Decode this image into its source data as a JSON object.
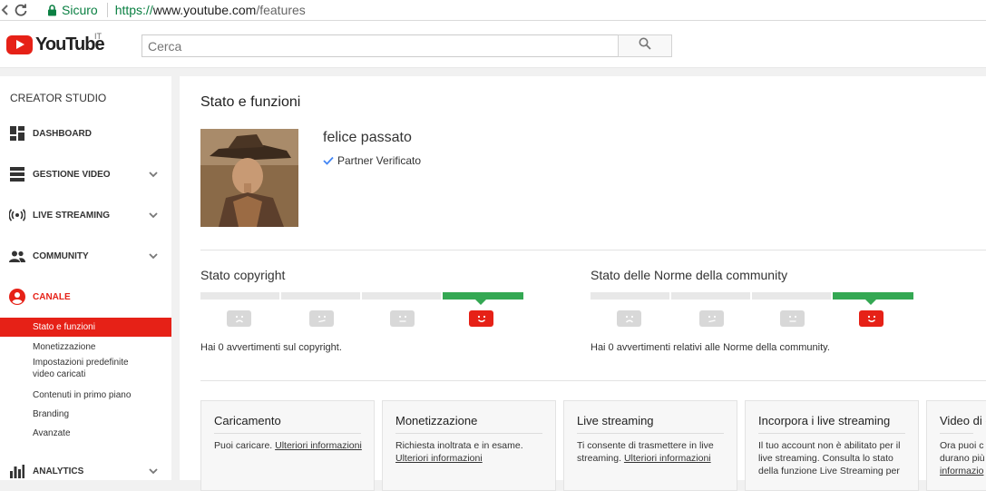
{
  "browser": {
    "secure_label": "Sicuro",
    "url_protocol": "https://",
    "url_host": "www.youtube.com",
    "url_path": "/features"
  },
  "header": {
    "logo_text": "YouTube",
    "country_code": "IT",
    "search_placeholder": "Cerca",
    "brand_color": "#e62117"
  },
  "sidebar": {
    "title": "CREATOR STUDIO",
    "items": [
      {
        "label": "DASHBOARD",
        "icon": "dashboard-icon"
      },
      {
        "label": "GESTIONE VIDEO",
        "icon": "video-manager-icon"
      },
      {
        "label": "LIVE STREAMING",
        "icon": "live-streaming-icon"
      },
      {
        "label": "COMMUNITY",
        "icon": "community-icon"
      },
      {
        "label": "CANALE",
        "icon": "channel-icon",
        "active": true
      },
      {
        "label": "ANALYTICS",
        "icon": "analytics-icon"
      }
    ],
    "subitems": [
      {
        "label": "Stato e funzioni",
        "active": true
      },
      {
        "label": "Monetizzazione"
      },
      {
        "label": "Impostazioni predefinite video caricati"
      },
      {
        "label": "Contenuti in primo piano"
      },
      {
        "label": "Branding"
      },
      {
        "label": "Avanzate"
      }
    ]
  },
  "main": {
    "title": "Stato e funzioni",
    "channel_name": "felice passato",
    "verified_label": "Partner Verificato",
    "copyright": {
      "title": "Stato copyright",
      "text": "Hai 0 avvertimenti sul copyright."
    },
    "community": {
      "title": "Stato delle Norme della community",
      "text": "Hai 0 avvertimenti relativi alle Norme della community."
    },
    "cards": [
      {
        "title": "Caricamento",
        "text": "Puoi caricare. ",
        "link": "Ulteriori informazioni"
      },
      {
        "title": "Monetizzazione",
        "text": "Richiesta inoltrata e in esame. ",
        "link": "Ulteriori informazioni"
      },
      {
        "title": "Live streaming",
        "text": "Ti consente di trasmettere in live streaming. ",
        "link": "Ulteriori informazioni"
      },
      {
        "title": "Incorpora i live streaming",
        "text": "Il tuo account non è abilitato per il live streaming. Consulta lo stato della funzione Live Streaming per",
        "link": ""
      },
      {
        "title": "Video di c",
        "text": "Ora puoi c durano più",
        "link": "informazio"
      }
    ],
    "status_colors": {
      "good": "#34a853",
      "active_face": "#e62117"
    }
  }
}
